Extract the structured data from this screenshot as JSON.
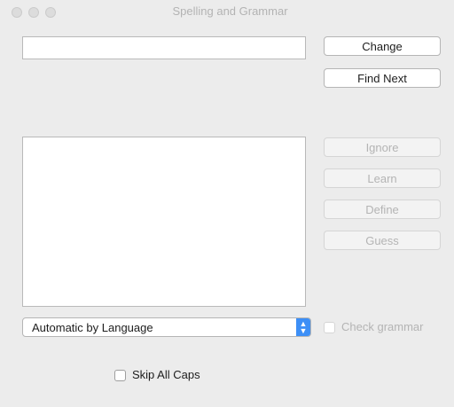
{
  "window": {
    "title": "Spelling and Grammar"
  },
  "word_field": {
    "value": ""
  },
  "buttons": {
    "change": "Change",
    "find_next": "Find Next",
    "ignore": "Ignore",
    "learn": "Learn",
    "define": "Define",
    "guess": "Guess"
  },
  "language_select": {
    "selected": "Automatic by Language"
  },
  "check_grammar": {
    "label": "Check grammar",
    "checked": false,
    "enabled": false
  },
  "skip_all_caps": {
    "label": "Skip All Caps",
    "checked": false
  },
  "colors": {
    "accent": "#3d8ff6",
    "window_bg": "#ececec",
    "disabled_text": "#b4b4b4"
  }
}
